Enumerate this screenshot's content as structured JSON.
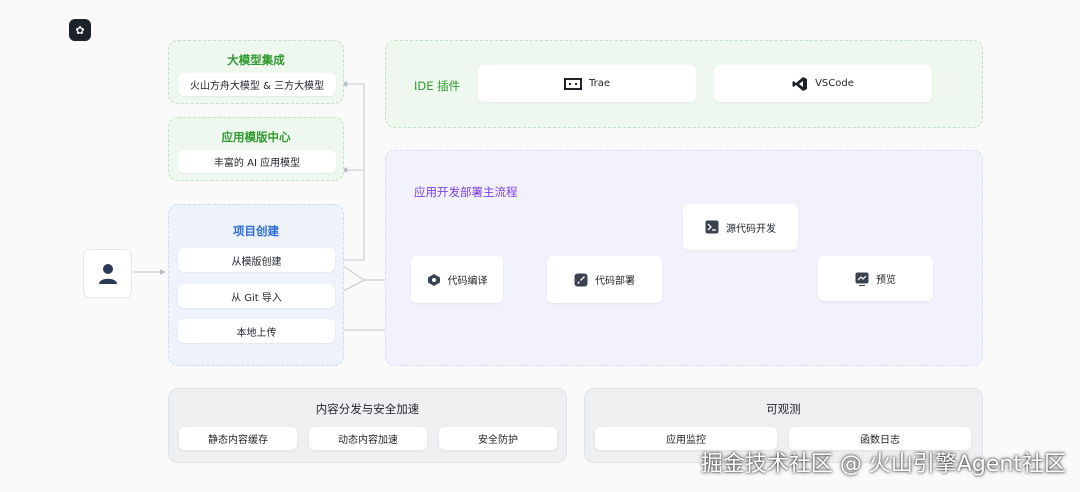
{
  "llm_integration": {
    "title": "大模型集成",
    "item": "火山方舟大模型 & 三方大模型"
  },
  "template_center": {
    "title": "应用模版中心",
    "item": "丰富的 AI 应用模型"
  },
  "project_create": {
    "title": "项目创建",
    "items": [
      "从模版创建",
      "从 Git 导入",
      "本地上传"
    ]
  },
  "ide_plugin": {
    "title": "IDE 插件",
    "items": [
      {
        "label": "Trae",
        "icon": "trae-icon"
      },
      {
        "label": "VSCode",
        "icon": "vscode-icon"
      }
    ]
  },
  "main_flow": {
    "title": "应用开发部署主流程",
    "nodes": {
      "compile": {
        "label": "代码编译",
        "icon": "compile-icon"
      },
      "deploy": {
        "label": "代码部署",
        "icon": "rocket-icon"
      },
      "source": {
        "label": "源代码开发",
        "icon": "terminal-icon"
      },
      "preview": {
        "label": "预览",
        "icon": "preview-icon"
      }
    }
  },
  "cdn": {
    "title": "内容分发与安全加速",
    "items": [
      "静态内容缓存",
      "动态内容加速",
      "安全防护"
    ]
  },
  "observability": {
    "title": "可观测",
    "items": [
      "应用监控",
      "函数日志"
    ]
  },
  "watermark": "掘金技术社区 @ 火山引擎Agent社区",
  "colors": {
    "green": "#2f9a2f",
    "blue": "#2d6cd8",
    "purple": "#7b3fe4",
    "line": "#b8bcc4"
  }
}
